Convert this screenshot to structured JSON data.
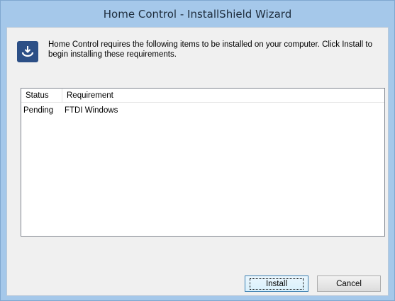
{
  "window": {
    "title": "Home Control - InstallShield Wizard"
  },
  "header": {
    "icon": "installer-icon",
    "message": "Home Control requires the following items to be installed on your computer. Click Install to begin installing these requirements."
  },
  "requirements": {
    "columns": [
      "Status",
      "Requirement"
    ],
    "rows": [
      {
        "status": "Pending",
        "requirement": "FTDI Windows"
      }
    ]
  },
  "buttons": {
    "install_label": "Install",
    "cancel_label": "Cancel"
  }
}
